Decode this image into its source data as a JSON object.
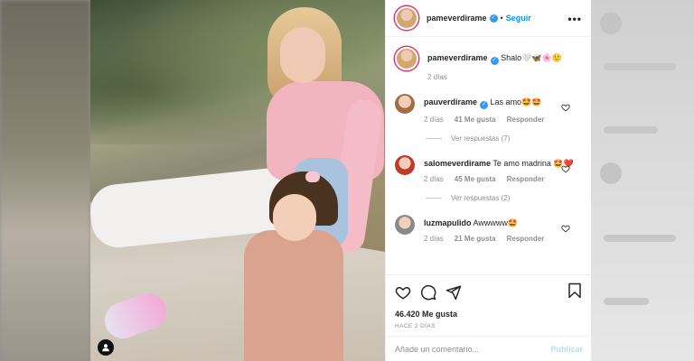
{
  "post": {
    "username": "pameverdirame",
    "follow_label": "Seguir",
    "caption_text": "Shalo🤍🦋🌸🙂",
    "caption_time": "2 días"
  },
  "comments": [
    {
      "username": "pauverdirame",
      "verified": true,
      "text": "Las amo🤩🤩",
      "time": "2 días",
      "likes": "41 Me gusta",
      "reply": "Responder",
      "view_replies": "Ver respuestas (7)"
    },
    {
      "username": "salomeverdirame",
      "verified": false,
      "text": "Te amo madrina 🤩❤️",
      "time": "2 días",
      "likes": "45 Me gusta",
      "reply": "Responder",
      "view_replies": "Ver respuestas (2)"
    },
    {
      "username": "luzmapulido",
      "verified": false,
      "text": "Awwwww🤩",
      "time": "2 días",
      "likes": "21 Me gusta",
      "reply": "Responder"
    }
  ],
  "stats": {
    "likes": "46.420 Me gusta",
    "posted": "HACE 2 DÍAS"
  },
  "add_comment": {
    "placeholder": "Añade un comentario...",
    "publish_label": "Publicar"
  },
  "icons": {
    "like": "heart-icon",
    "comment": "comment-icon",
    "share": "share-icon",
    "save": "bookmark-icon",
    "more": "more-icon",
    "verified": "verified-badge-icon",
    "user_tag": "user-tag-icon"
  },
  "colors": {
    "accent": "#0095f6",
    "verified": "#3897f0",
    "muted": "#8e8e8e",
    "publish_disabled": "#b2dffc"
  }
}
